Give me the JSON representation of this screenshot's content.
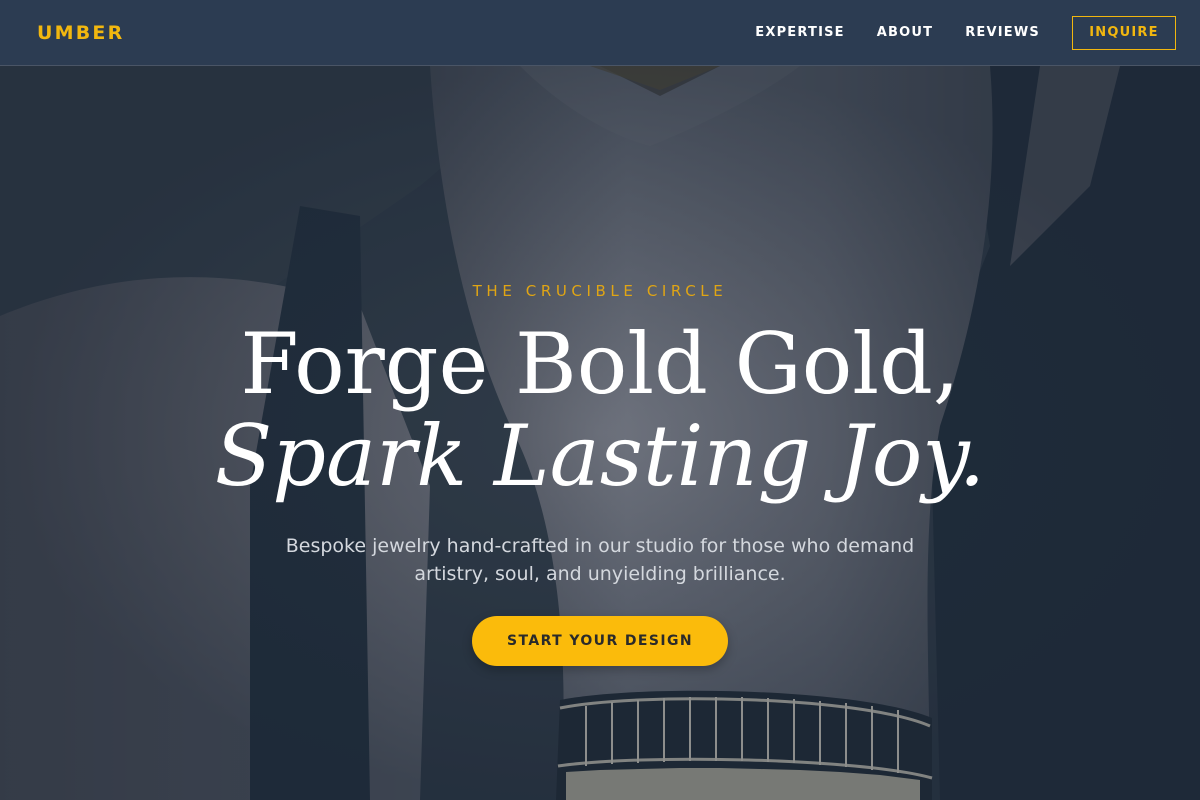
{
  "header": {
    "brand": "UMBER",
    "nav": [
      {
        "label": "EXPERTISE"
      },
      {
        "label": "ABOUT"
      },
      {
        "label": "REVIEWS"
      }
    ],
    "inquire_label": "INQUIRE"
  },
  "hero": {
    "eyebrow": "THE CRUCIBLE CIRCLE",
    "headline_line1": "Forge Bold Gold,",
    "headline_line2": "Spark Lasting Joy.",
    "subtext": "Bespoke jewelry hand-crafted in our studio for those who demand artistry, soul, and unyielding brilliance.",
    "cta_label": "START YOUR DESIGN"
  },
  "colors": {
    "accent": "#f2b70f",
    "header_bg": "#2c3c52",
    "cta_bg": "#fbbb0b"
  }
}
